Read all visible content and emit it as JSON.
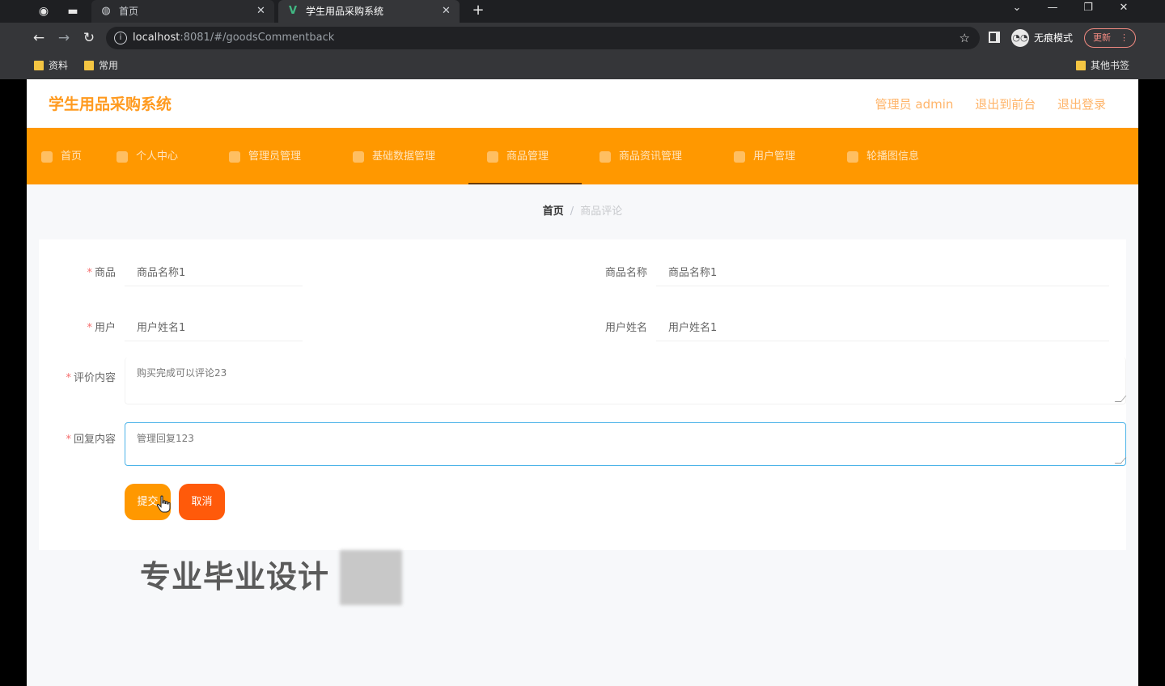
{
  "browser": {
    "tabs": [
      {
        "title": "首页",
        "icon": "globe-icon",
        "active": false
      },
      {
        "title": "学生用品采购系统",
        "icon": "vue-icon",
        "active": true
      }
    ],
    "url_host": "localhost",
    "url_rest": ":8081/#/goodsCommentback",
    "incognito_label": "无痕模式",
    "update_label": "更新",
    "bookmarks": [
      "资料",
      "常用"
    ],
    "other_bookmarks": "其他书签"
  },
  "header": {
    "brand": "学生用品采购系统",
    "admin_label": "管理员 admin",
    "back_to_front": "退出到前台",
    "logout": "退出登录"
  },
  "menu": {
    "items": [
      "首页",
      "个人中心",
      "管理员管理",
      "基础数据管理",
      "商品管理",
      "商品资讯管理",
      "用户管理",
      "轮播图信息"
    ],
    "active_index": 4
  },
  "breadcrumb": {
    "home": "首页",
    "separator": "/",
    "current": "商品评论"
  },
  "form": {
    "goods_label": "商品",
    "goods_value": "商品名称1",
    "goods_name_label": "商品名称",
    "goods_name_value": "商品名称1",
    "user_label": "用户",
    "user_value": "用户姓名1",
    "user_name_label": "用户姓名",
    "user_name_value": "用户姓名1",
    "comment_label": "评价内容",
    "comment_value": "购买完成可以评论23",
    "reply_label": "回复内容",
    "reply_value": "管理回复123",
    "submit_label": "提交",
    "cancel_label": "取消",
    "required_mark": "*"
  },
  "overlay": {
    "watermark": "专业毕业设计"
  },
  "colors": {
    "brand_orange": "#ff9800",
    "cancel_red": "#ff5a0a",
    "focus_blue": "#4bb3e8"
  }
}
